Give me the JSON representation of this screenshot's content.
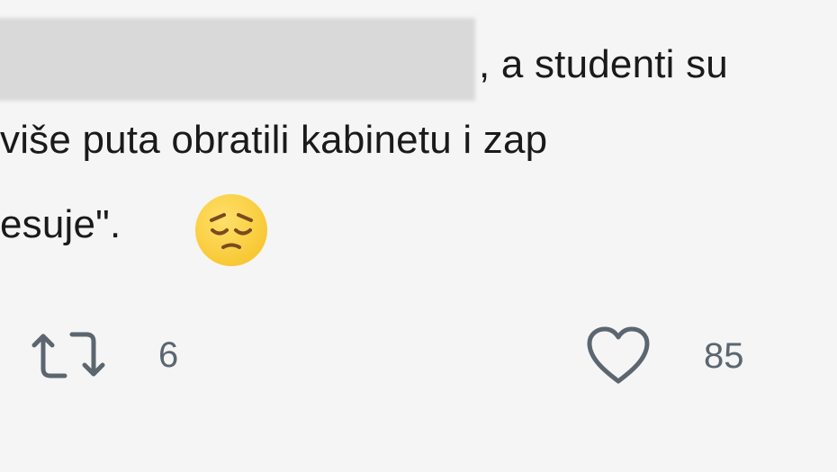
{
  "tweet": {
    "line1_text": ", a studenti su",
    "line2_text": "više puta obratili kabinetu i zap",
    "line3_text": "esuje\".",
    "emoji": "pensive-face-emoji"
  },
  "actions": {
    "retweet_count": "6",
    "like_count": "85"
  },
  "colors": {
    "background": "#f5f5f5",
    "text": "#1a1a1a",
    "icon_gray": "#5b6670",
    "emoji_yellow": "#ffcc33",
    "redaction_gray": "#d9d9d9"
  },
  "icons": {
    "retweet": "retweet-icon",
    "like": "heart-icon"
  }
}
